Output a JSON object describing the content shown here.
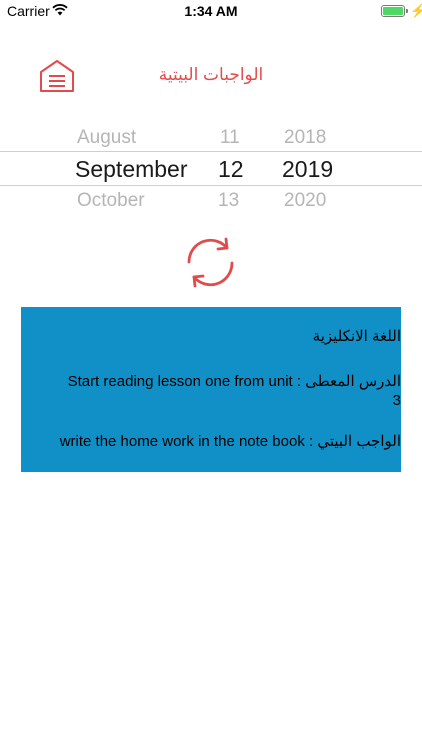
{
  "status_bar": {
    "carrier": "Carrier",
    "time": "1:34 AM",
    "charging_symbol": "⚡"
  },
  "header": {
    "menu_icon": "home-menu-icon",
    "title": "الواجبات البيتية"
  },
  "date_picker": {
    "months": [
      "August",
      "September",
      "October"
    ],
    "days": [
      "11",
      "12",
      "13"
    ],
    "years": [
      "2018",
      "2019",
      "2020"
    ],
    "selected": {
      "month": "September",
      "day": "12",
      "year": "2019"
    }
  },
  "refresh": {
    "icon": "refresh-icon"
  },
  "homework": {
    "subject": "اللغة الانكليزية",
    "lesson_text": "الدرس المعطى : Start reading lesson one from unit 3",
    "homework_text": "الواجب البيتي : write the home work in the note book"
  },
  "colors": {
    "accent": "#e24b4b",
    "card_background": "#1190c7",
    "battery": "#4cd964"
  }
}
